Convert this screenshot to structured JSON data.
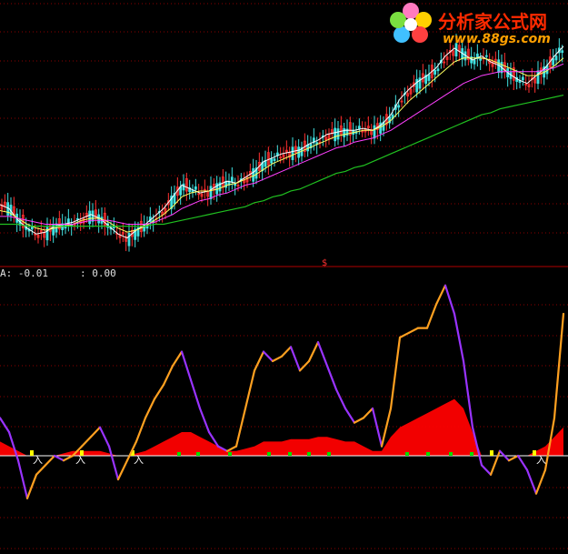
{
  "watermark": {
    "brand": "分析家公式网",
    "url": "www.88gs.com"
  },
  "indicator_readouts": [
    {
      "label": "A: -0.01"
    },
    {
      "label": ": 0.00"
    }
  ],
  "pane_divider_marker": "$",
  "signal_labels": [
    "入",
    "入",
    "入",
    "入"
  ],
  "colors": {
    "background": "#000000",
    "grid": "#8b0000",
    "candle_up": "#ff3030",
    "candle_down": "#40e0e0",
    "ma_short": "#ffffff",
    "ma_mid": "#ffff60",
    "ma_long": "#ff40ff",
    "ma_slow": "#20c020",
    "osc_rising": "#ffa020",
    "osc_falling": "#9933ff",
    "fill_red": "#ff0000",
    "zero_line": "#ffffff",
    "dot_green": "#00e000",
    "dot_yellow": "#ffff00"
  },
  "chart_data": [
    {
      "type": "line",
      "title": "",
      "note": "price pane (candlesticks with moving averages); axes not labeled",
      "x": [
        0,
        10,
        20,
        30,
        40,
        50,
        60,
        70,
        80,
        90,
        100,
        110,
        120,
        130,
        140,
        150,
        160,
        170,
        180,
        190,
        200,
        210,
        220,
        230,
        240,
        250,
        260,
        270,
        280,
        290,
        300,
        310,
        320,
        330,
        340,
        350,
        360,
        370,
        380,
        390,
        400,
        410,
        420,
        430,
        440,
        450,
        460,
        470,
        480,
        490,
        500,
        510,
        520,
        530,
        540,
        550,
        560,
        570,
        580,
        590,
        600,
        610,
        620
      ],
      "series": [
        {
          "values": [
            20,
            18,
            12,
            8,
            5,
            6,
            9,
            10,
            11,
            13,
            15,
            13,
            9,
            5,
            3,
            7,
            10,
            14,
            18,
            24,
            30,
            28,
            26,
            27,
            30,
            32,
            31,
            34,
            37,
            42,
            44,
            46,
            47,
            48,
            51,
            53,
            56,
            57,
            58,
            58,
            59,
            58,
            61,
            66,
            74,
            79,
            83,
            86,
            90,
            96,
            100,
            97,
            94,
            96,
            93,
            91,
            87,
            84,
            82,
            86,
            90,
            96,
            101
          ]
        },
        {
          "values": [
            17,
            16,
            13,
            10,
            8,
            7,
            8,
            9,
            10,
            12,
            13,
            13,
            11,
            8,
            6,
            7,
            9,
            12,
            15,
            19,
            24,
            26,
            27,
            27,
            28,
            30,
            31,
            33,
            35,
            38,
            41,
            43,
            45,
            47,
            49,
            51,
            53,
            55,
            56,
            57,
            58,
            58,
            60,
            63,
            68,
            73,
            77,
            81,
            85,
            89,
            93,
            95,
            95,
            95,
            94,
            92,
            90,
            88,
            86,
            86,
            88,
            91,
            95
          ]
        },
        {
          "values": [
            14,
            14,
            13,
            12,
            11,
            10,
            10,
            10,
            10,
            11,
            12,
            12,
            12,
            11,
            10,
            10,
            10,
            11,
            13,
            15,
            18,
            20,
            22,
            23,
            25,
            26,
            28,
            30,
            31,
            33,
            35,
            37,
            39,
            41,
            43,
            45,
            47,
            49,
            50,
            52,
            53,
            54,
            56,
            58,
            61,
            64,
            67,
            70,
            73,
            76,
            79,
            82,
            84,
            86,
            87,
            88,
            88,
            88,
            88,
            88,
            89,
            90,
            92
          ]
        },
        {
          "values": [
            10,
            10,
            10,
            9,
            9,
            9,
            9,
            9,
            9,
            9,
            9,
            9,
            9,
            9,
            9,
            9,
            9,
            10,
            10,
            11,
            12,
            13,
            14,
            15,
            16,
            17,
            18,
            19,
            21,
            22,
            24,
            25,
            27,
            28,
            30,
            32,
            34,
            36,
            37,
            39,
            40,
            42,
            44,
            46,
            48,
            50,
            52,
            54,
            56,
            58,
            60,
            62,
            64,
            66,
            67,
            69,
            70,
            71,
            72,
            73,
            74,
            75,
            76
          ]
        }
      ]
    },
    {
      "type": "line",
      "title": "",
      "note": "oscillator pane; zero line at 0; red bands are a filled histogram",
      "x": [
        0,
        10,
        20,
        30,
        40,
        50,
        60,
        70,
        80,
        90,
        100,
        110,
        120,
        130,
        140,
        150,
        160,
        170,
        180,
        190,
        200,
        210,
        220,
        230,
        240,
        250,
        260,
        270,
        280,
        290,
        300,
        310,
        320,
        330,
        340,
        350,
        360,
        370,
        380,
        390,
        400,
        410,
        420,
        430,
        440,
        450,
        460,
        470,
        480,
        490,
        500,
        510,
        520,
        530,
        540,
        550,
        560,
        570,
        580,
        590,
        600,
        610,
        620
      ],
      "ylim": [
        -1.0,
        3.7
      ],
      "series": [
        {
          "values": [
            0.8,
            0.5,
            -0.1,
            -0.9,
            -0.4,
            -0.2,
            0.0,
            -0.1,
            0.0,
            0.2,
            0.4,
            0.6,
            0.2,
            -0.5,
            -0.1,
            0.3,
            0.8,
            1.2,
            1.5,
            1.9,
            2.2,
            1.6,
            1.0,
            0.5,
            0.2,
            0.1,
            0.2,
            1.0,
            1.8,
            2.2,
            2.0,
            2.1,
            2.3,
            1.8,
            2.0,
            2.4,
            1.9,
            1.4,
            1.0,
            0.7,
            0.8,
            1.0,
            0.2,
            1.0,
            2.5,
            2.6,
            2.7,
            2.7,
            3.2,
            3.6,
            3.0,
            2.0,
            0.6,
            -0.2,
            -0.4,
            0.1,
            -0.1,
            0.0,
            -0.3,
            -0.8,
            -0.3,
            0.8,
            3.0
          ]
        },
        {
          "values": [
            0.3,
            0.2,
            0.1,
            0.0,
            0.0,
            0.0,
            0.0,
            0.05,
            0.1,
            0.1,
            0.1,
            0.1,
            0.05,
            0.0,
            0.0,
            0.05,
            0.1,
            0.2,
            0.3,
            0.4,
            0.5,
            0.5,
            0.4,
            0.3,
            0.2,
            0.1,
            0.1,
            0.15,
            0.2,
            0.3,
            0.3,
            0.3,
            0.35,
            0.35,
            0.35,
            0.4,
            0.4,
            0.35,
            0.3,
            0.3,
            0.2,
            0.1,
            0.1,
            0.4,
            0.6,
            0.7,
            0.8,
            0.9,
            1.0,
            1.1,
            1.2,
            1.0,
            0.5,
            0.0,
            0.0,
            0.0,
            0.0,
            0.0,
            0.0,
            0.1,
            0.2,
            0.4,
            0.6
          ]
        }
      ]
    }
  ]
}
